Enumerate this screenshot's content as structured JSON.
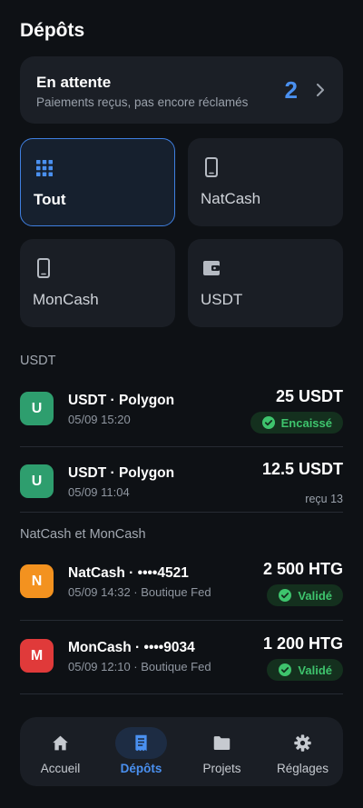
{
  "header": {
    "title": "Dépôts"
  },
  "pending": {
    "title": "En attente",
    "subtitle": "Paiements reçus, pas encore réclamés",
    "count": "2"
  },
  "filters": [
    {
      "label": "Tout",
      "icon": "grid-icon",
      "active": true
    },
    {
      "label": "NatCash",
      "icon": "phone-icon",
      "active": false
    },
    {
      "label": "MonCash",
      "icon": "phone-icon",
      "active": false
    },
    {
      "label": "USDT",
      "icon": "wallet-icon",
      "active": false
    }
  ],
  "sections": {
    "usdt": {
      "title": "USDT",
      "items": [
        {
          "initial": "U",
          "title": "USDT · Polygon",
          "sub": "05/09 15:20",
          "amount": "25 USDT",
          "status": "Encaissé",
          "color": "#2e9e6e"
        },
        {
          "initial": "U",
          "title": "USDT · Polygon",
          "sub": "05/09 11:04",
          "amount": "12.5 USDT",
          "note": "reçu 13",
          "color": "#2e9e6e"
        }
      ]
    },
    "mobile": {
      "title": "NatCash et MonCash",
      "items": [
        {
          "initial": "N",
          "title": "NatCash · ••••4521",
          "sub": "05/09 14:32 · Boutique Fed",
          "amount": "2 500 HTG",
          "status": "Validé",
          "color": "#f3921f"
        },
        {
          "initial": "M",
          "title": "MonCash · ••••9034",
          "sub": "05/09 12:10 · Boutique Fed",
          "amount": "1 200 HTG",
          "status": "Validé",
          "color": "#e03a3a"
        }
      ]
    }
  },
  "nav": [
    {
      "label": "Accueil",
      "icon": "home-icon",
      "active": false
    },
    {
      "label": "Dépôts",
      "icon": "receipt-icon",
      "active": true
    },
    {
      "label": "Projets",
      "icon": "folder-icon",
      "active": false
    },
    {
      "label": "Réglages",
      "icon": "gear-icon",
      "active": false
    }
  ],
  "colors": {
    "accent": "#4a90f0",
    "success": "#3ec46d",
    "background": "#0e1115",
    "card": "#1a1e25"
  }
}
